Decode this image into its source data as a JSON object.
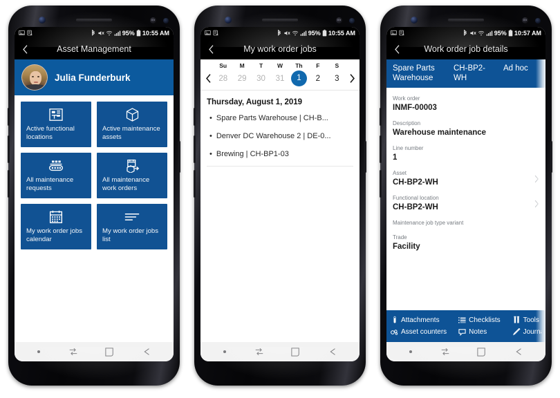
{
  "phones": [
    {
      "id": "asset-management",
      "statusbar": {
        "icons_left": [
          "image-icon",
          "screenshot-disabled-icon"
        ],
        "bluetooth": "bluetooth-icon",
        "mute": "mute-icon",
        "wifi": "wifi-icon",
        "signal": "signal-icon",
        "battery_text": "95%",
        "battery": "battery-icon",
        "time": "10:55 AM"
      },
      "appbar": {
        "back": "back-chevron-icon",
        "title": "Asset Management"
      },
      "profile": {
        "name": "Julia Funderburk",
        "avatar": "user-avatar"
      },
      "tiles": [
        {
          "icon": "floorplan-icon",
          "label": "Active functional locations"
        },
        {
          "icon": "box-icon",
          "label": "Active maintenance assets"
        },
        {
          "icon": "conveyor-icon",
          "label": "All maintenance requests"
        },
        {
          "icon": "workorder-arrow-icon",
          "label": "All maintenance work orders"
        },
        {
          "icon": "calendar-icon",
          "label": "My work order jobs calendar"
        },
        {
          "icon": "list-lines-icon",
          "label": "My work order jobs list"
        }
      ]
    },
    {
      "id": "my-work-order-jobs",
      "statusbar": {
        "battery_text": "95%",
        "time": "10:55 AM"
      },
      "appbar": {
        "back": "back-chevron-icon",
        "title": "My work order jobs"
      },
      "calendar": {
        "prev": "prev-week-icon",
        "next": "next-week-icon",
        "dow": [
          "Su",
          "M",
          "T",
          "W",
          "Th",
          "F",
          "S"
        ],
        "days": [
          {
            "n": "28",
            "state": "muted"
          },
          {
            "n": "29",
            "state": "muted"
          },
          {
            "n": "30",
            "state": "muted"
          },
          {
            "n": "31",
            "state": "muted"
          },
          {
            "n": "1",
            "state": "selected"
          },
          {
            "n": "2",
            "state": "normal"
          },
          {
            "n": "3",
            "state": "normal"
          }
        ]
      },
      "day_title": "Thursday, August 1, 2019",
      "jobs": [
        "Spare Parts Warehouse | CH-B...",
        "Denver DC Warehouse 2 | DE-0...",
        "Brewing | CH-BP1-03"
      ]
    },
    {
      "id": "work-order-job-details",
      "statusbar": {
        "battery_text": "95%",
        "time": "10:57 AM"
      },
      "appbar": {
        "back": "back-chevron-icon",
        "title": "Work order job details"
      },
      "context": {
        "col1": "Spare Parts Warehouse",
        "col2": "CH-BP2-WH",
        "col3": "Ad hoc"
      },
      "fields": [
        {
          "label": "Work order",
          "value": "INMF-00003",
          "chevron": false
        },
        {
          "label": "Description",
          "value": "Warehouse maintenance",
          "chevron": false
        },
        {
          "label": "Line number",
          "value": "1",
          "chevron": false
        },
        {
          "label": "Asset",
          "value": "CH-BP2-WH",
          "chevron": true
        },
        {
          "label": "Functional location",
          "value": "CH-BP2-WH",
          "chevron": true
        },
        {
          "label": "Maintenance job type variant",
          "value": "",
          "chevron": false
        },
        {
          "label": "Trade",
          "value": "Facility",
          "chevron": false
        }
      ],
      "actions": [
        {
          "icon": "paperclip-icon",
          "label": "Attachments"
        },
        {
          "icon": "checklist-icon",
          "label": "Checklists"
        },
        {
          "icon": "tools-icon",
          "label": "Tools"
        },
        {
          "icon": "asset-counter-icon",
          "label": "Asset counters"
        },
        {
          "icon": "note-icon",
          "label": "Notes"
        },
        {
          "icon": "pencil-icon",
          "label": "Journals"
        }
      ]
    }
  ],
  "navbar": {
    "items": [
      "dot-icon",
      "recents-icon",
      "home-icon",
      "back-arrow-icon"
    ]
  },
  "colors": {
    "brand_blue": "#115293",
    "header_blue": "#0e5396",
    "selected_day": "#1169ae",
    "status_black": "#000000"
  }
}
